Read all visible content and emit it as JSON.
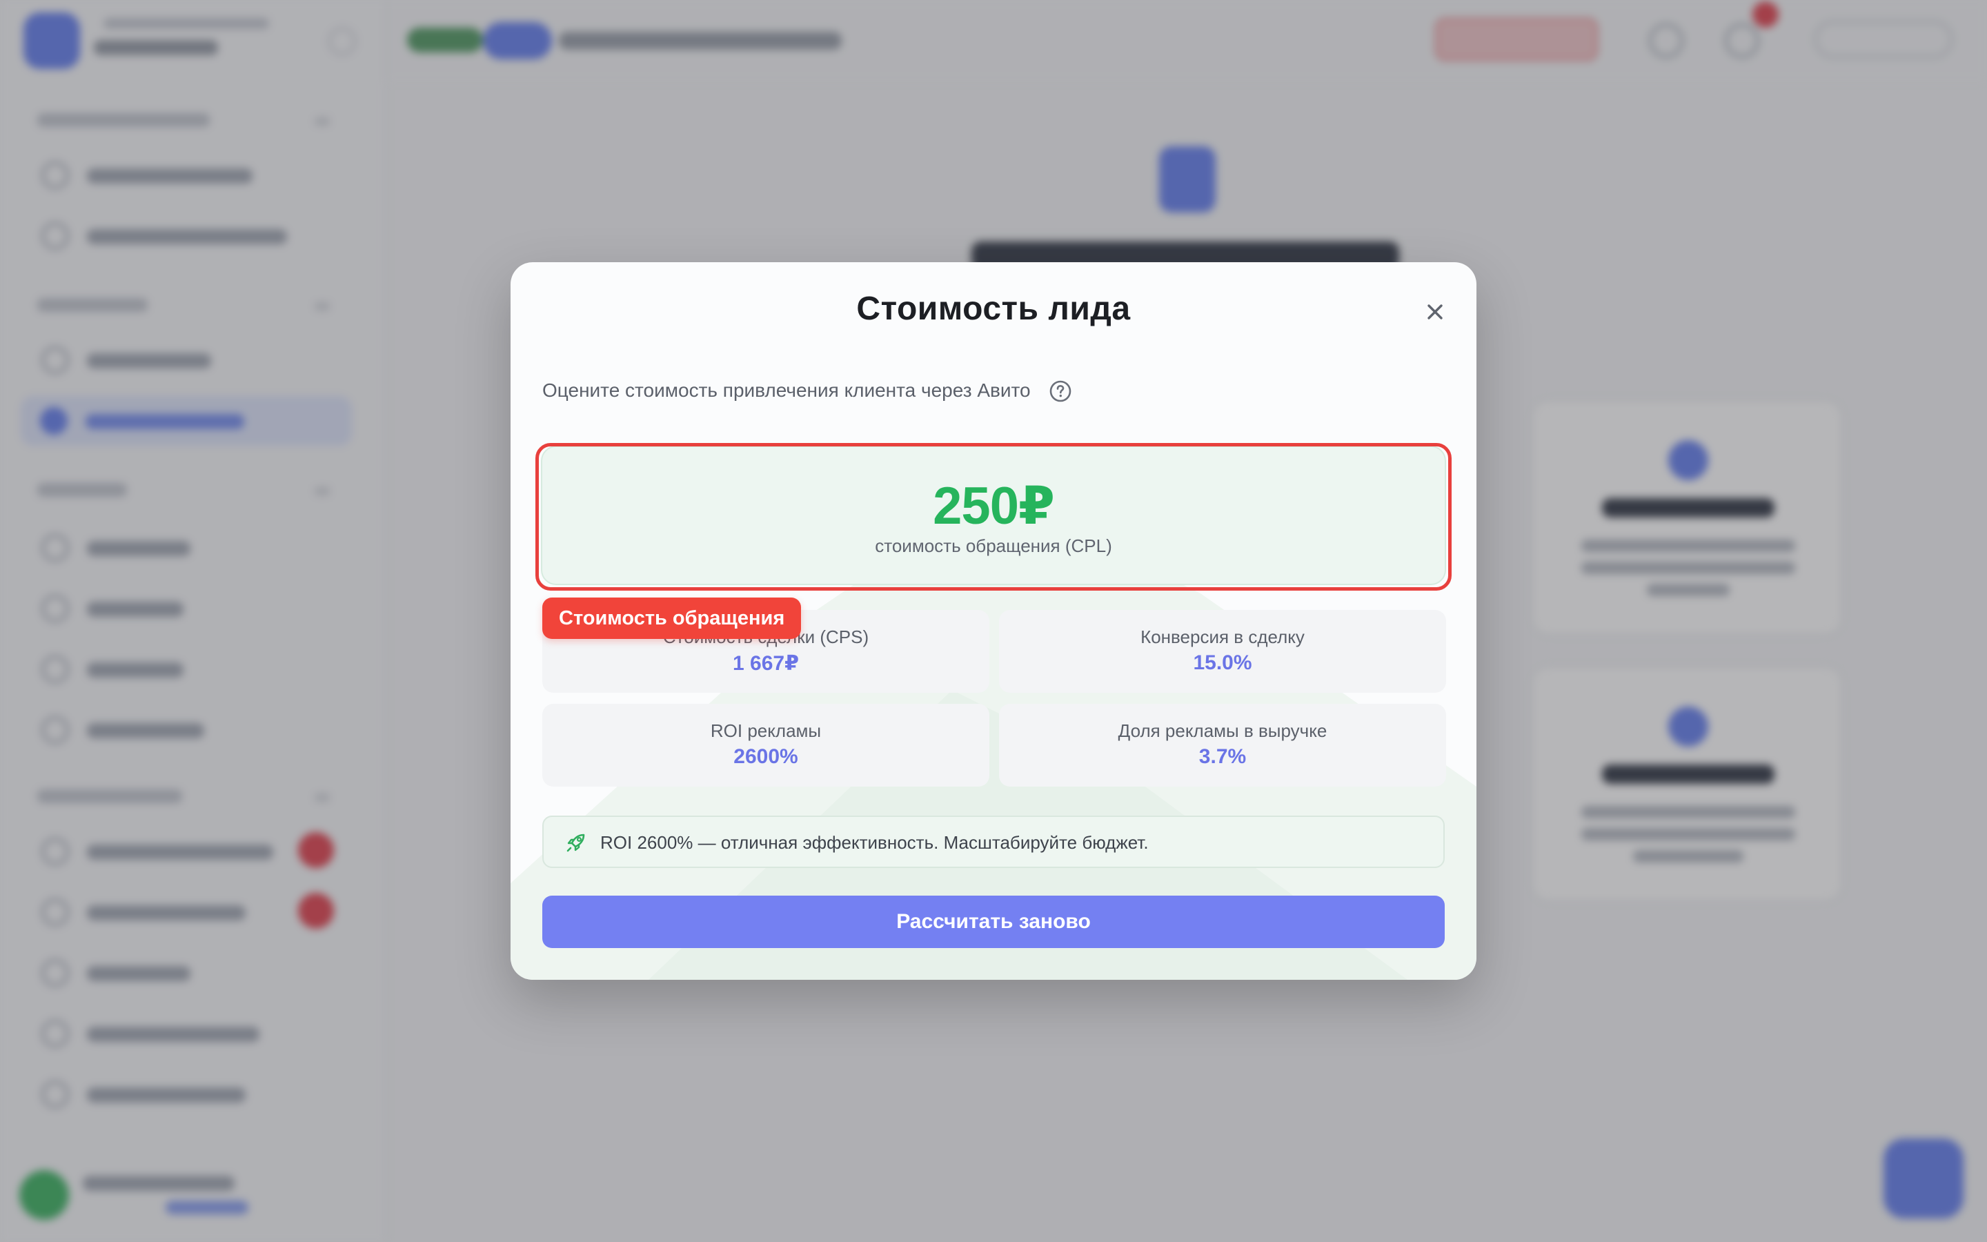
{
  "modal": {
    "title": "Стоимость лида",
    "subtitle": "Оцените стоимость привлечения клиента через Авито",
    "close_icon": "close-icon",
    "help_icon": "question-circle-icon",
    "cpl": {
      "value": "250₽",
      "label": "стоимость обращения (CPL)"
    },
    "highlight_tag": "Стоимость обращения",
    "stats": [
      {
        "label": "Стоимость сделки (CPS)",
        "value": "1 667₽"
      },
      {
        "label": "Конверсия в сделку",
        "value": "15.0%"
      },
      {
        "label": "ROI рекламы",
        "value": "2600%"
      },
      {
        "label": "Доля рекламы в выручке",
        "value": "3.7%"
      }
    ],
    "note": {
      "icon": "rocket-icon",
      "text": "ROI 2600% — отличная эффективность. Масштабируйте бюджет."
    },
    "recalculate_label": "Рассчитать заново"
  },
  "colors": {
    "accent": "#7480f2",
    "success": "#26b45c",
    "stat_value": "#6a74e6",
    "highlight": "#e8403d",
    "tag_bg": "#f1443a"
  }
}
